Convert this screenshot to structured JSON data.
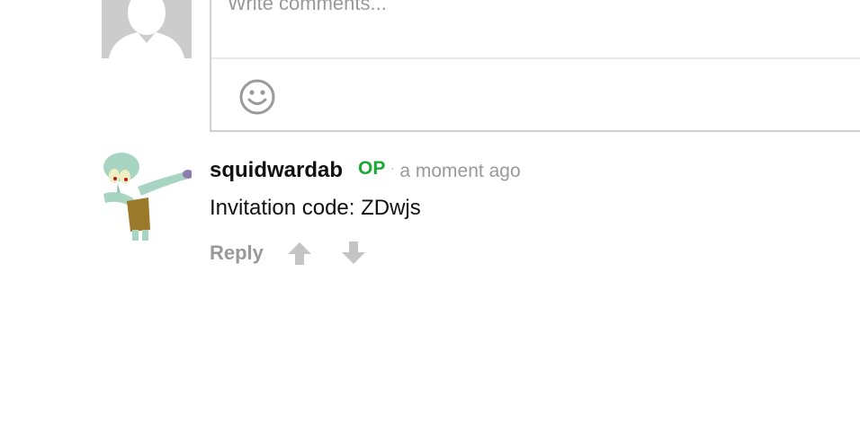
{
  "composer": {
    "placeholder": "Write comments...",
    "avatar_icon": "default-user-avatar",
    "emoji_icon": "smiley-face-icon"
  },
  "comment": {
    "author": "squidwardab",
    "badge": "OP",
    "separator": "·",
    "timestamp": "a moment ago",
    "body": "Invitation code: ZDwjs",
    "avatar_icon": "squidward-dab-avatar",
    "actions": {
      "reply_label": "Reply",
      "upvote_icon": "arrow-up-icon",
      "downvote_icon": "arrow-down-icon"
    }
  },
  "colors": {
    "op_badge": "#1ca836",
    "muted": "#999999",
    "border": "#d0d0d0",
    "avatar_placeholder": "#cccccc"
  }
}
